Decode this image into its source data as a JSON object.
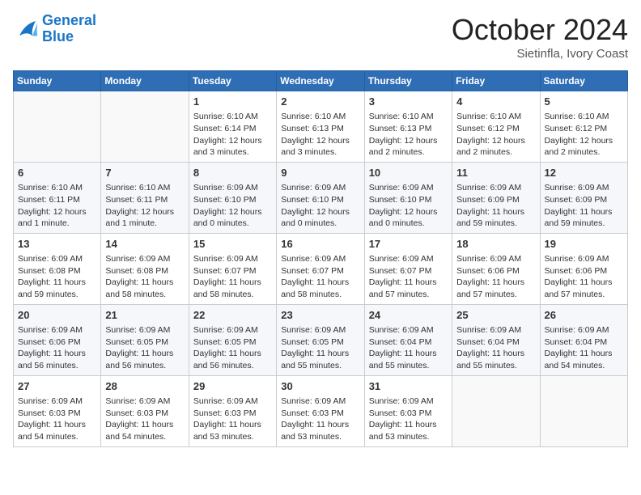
{
  "header": {
    "logo_line1": "General",
    "logo_line2": "Blue",
    "month": "October 2024",
    "location": "Sietinfla, Ivory Coast"
  },
  "weekdays": [
    "Sunday",
    "Monday",
    "Tuesday",
    "Wednesday",
    "Thursday",
    "Friday",
    "Saturday"
  ],
  "weeks": [
    [
      {
        "day": "",
        "info": ""
      },
      {
        "day": "",
        "info": ""
      },
      {
        "day": "1",
        "info": "Sunrise: 6:10 AM\nSunset: 6:14 PM\nDaylight: 12 hours and 3 minutes."
      },
      {
        "day": "2",
        "info": "Sunrise: 6:10 AM\nSunset: 6:13 PM\nDaylight: 12 hours and 3 minutes."
      },
      {
        "day": "3",
        "info": "Sunrise: 6:10 AM\nSunset: 6:13 PM\nDaylight: 12 hours and 2 minutes."
      },
      {
        "day": "4",
        "info": "Sunrise: 6:10 AM\nSunset: 6:12 PM\nDaylight: 12 hours and 2 minutes."
      },
      {
        "day": "5",
        "info": "Sunrise: 6:10 AM\nSunset: 6:12 PM\nDaylight: 12 hours and 2 minutes."
      }
    ],
    [
      {
        "day": "6",
        "info": "Sunrise: 6:10 AM\nSunset: 6:11 PM\nDaylight: 12 hours and 1 minute."
      },
      {
        "day": "7",
        "info": "Sunrise: 6:10 AM\nSunset: 6:11 PM\nDaylight: 12 hours and 1 minute."
      },
      {
        "day": "8",
        "info": "Sunrise: 6:09 AM\nSunset: 6:10 PM\nDaylight: 12 hours and 0 minutes."
      },
      {
        "day": "9",
        "info": "Sunrise: 6:09 AM\nSunset: 6:10 PM\nDaylight: 12 hours and 0 minutes."
      },
      {
        "day": "10",
        "info": "Sunrise: 6:09 AM\nSunset: 6:10 PM\nDaylight: 12 hours and 0 minutes."
      },
      {
        "day": "11",
        "info": "Sunrise: 6:09 AM\nSunset: 6:09 PM\nDaylight: 11 hours and 59 minutes."
      },
      {
        "day": "12",
        "info": "Sunrise: 6:09 AM\nSunset: 6:09 PM\nDaylight: 11 hours and 59 minutes."
      }
    ],
    [
      {
        "day": "13",
        "info": "Sunrise: 6:09 AM\nSunset: 6:08 PM\nDaylight: 11 hours and 59 minutes."
      },
      {
        "day": "14",
        "info": "Sunrise: 6:09 AM\nSunset: 6:08 PM\nDaylight: 11 hours and 58 minutes."
      },
      {
        "day": "15",
        "info": "Sunrise: 6:09 AM\nSunset: 6:07 PM\nDaylight: 11 hours and 58 minutes."
      },
      {
        "day": "16",
        "info": "Sunrise: 6:09 AM\nSunset: 6:07 PM\nDaylight: 11 hours and 58 minutes."
      },
      {
        "day": "17",
        "info": "Sunrise: 6:09 AM\nSunset: 6:07 PM\nDaylight: 11 hours and 57 minutes."
      },
      {
        "day": "18",
        "info": "Sunrise: 6:09 AM\nSunset: 6:06 PM\nDaylight: 11 hours and 57 minutes."
      },
      {
        "day": "19",
        "info": "Sunrise: 6:09 AM\nSunset: 6:06 PM\nDaylight: 11 hours and 57 minutes."
      }
    ],
    [
      {
        "day": "20",
        "info": "Sunrise: 6:09 AM\nSunset: 6:06 PM\nDaylight: 11 hours and 56 minutes."
      },
      {
        "day": "21",
        "info": "Sunrise: 6:09 AM\nSunset: 6:05 PM\nDaylight: 11 hours and 56 minutes."
      },
      {
        "day": "22",
        "info": "Sunrise: 6:09 AM\nSunset: 6:05 PM\nDaylight: 11 hours and 56 minutes."
      },
      {
        "day": "23",
        "info": "Sunrise: 6:09 AM\nSunset: 6:05 PM\nDaylight: 11 hours and 55 minutes."
      },
      {
        "day": "24",
        "info": "Sunrise: 6:09 AM\nSunset: 6:04 PM\nDaylight: 11 hours and 55 minutes."
      },
      {
        "day": "25",
        "info": "Sunrise: 6:09 AM\nSunset: 6:04 PM\nDaylight: 11 hours and 55 minutes."
      },
      {
        "day": "26",
        "info": "Sunrise: 6:09 AM\nSunset: 6:04 PM\nDaylight: 11 hours and 54 minutes."
      }
    ],
    [
      {
        "day": "27",
        "info": "Sunrise: 6:09 AM\nSunset: 6:03 PM\nDaylight: 11 hours and 54 minutes."
      },
      {
        "day": "28",
        "info": "Sunrise: 6:09 AM\nSunset: 6:03 PM\nDaylight: 11 hours and 54 minutes."
      },
      {
        "day": "29",
        "info": "Sunrise: 6:09 AM\nSunset: 6:03 PM\nDaylight: 11 hours and 53 minutes."
      },
      {
        "day": "30",
        "info": "Sunrise: 6:09 AM\nSunset: 6:03 PM\nDaylight: 11 hours and 53 minutes."
      },
      {
        "day": "31",
        "info": "Sunrise: 6:09 AM\nSunset: 6:03 PM\nDaylight: 11 hours and 53 minutes."
      },
      {
        "day": "",
        "info": ""
      },
      {
        "day": "",
        "info": ""
      }
    ]
  ]
}
